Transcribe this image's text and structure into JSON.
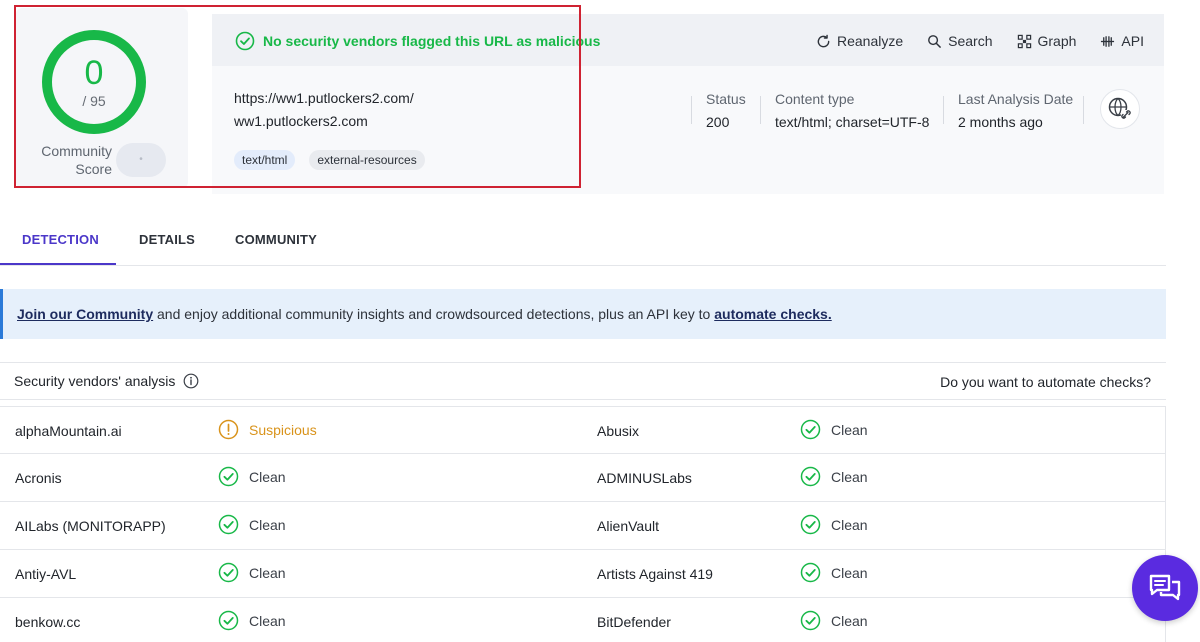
{
  "score": {
    "value": "0",
    "total": "/ 95",
    "community_label": "Community Score",
    "community_value": "•",
    "ring_color": "#18b848"
  },
  "verdict": {
    "text": "No security vendors flagged this URL as malicious",
    "color": "#18b848",
    "icon": "check-circle-icon"
  },
  "actions": [
    {
      "label": "Reanalyze",
      "icon": "refresh-icon"
    },
    {
      "label": "Search",
      "icon": "search-icon"
    },
    {
      "label": "Graph",
      "icon": "graph-icon"
    },
    {
      "label": "API",
      "icon": "api-icon"
    }
  ],
  "url": {
    "full": "https://ww1.putlockers2.com/",
    "host": "ww1.putlockers2.com",
    "tags": [
      "text/html",
      "external-resources"
    ]
  },
  "meta": {
    "status_label": "Status",
    "status_value": "200",
    "content_type_label": "Content type",
    "content_type_value": "text/html; charset=UTF-8",
    "last_analysis_label": "Last Analysis Date",
    "last_analysis_value": "2 months ago"
  },
  "tabs": [
    {
      "label": "DETECTION",
      "active": true
    },
    {
      "label": "DETAILS",
      "active": false
    },
    {
      "label": "COMMUNITY",
      "active": false
    }
  ],
  "banner": {
    "link1": "Join our Community",
    "text": " and enjoy additional community insights and crowdsourced detections, plus an API key to ",
    "link2": "automate checks."
  },
  "vendors_section": {
    "title": "Security vendors' analysis",
    "automate_prompt": "Do you want to automate checks?"
  },
  "vendors": [
    {
      "left": {
        "name": "alphaMountain.ai",
        "result": "Suspicious",
        "status": "suspicious"
      },
      "right": {
        "name": "Abusix",
        "result": "Clean",
        "status": "clean"
      }
    },
    {
      "left": {
        "name": "Acronis",
        "result": "Clean",
        "status": "clean"
      },
      "right": {
        "name": "ADMINUSLabs",
        "result": "Clean",
        "status": "clean"
      }
    },
    {
      "left": {
        "name": "AILabs (MONITORAPP)",
        "result": "Clean",
        "status": "clean"
      },
      "right": {
        "name": "AlienVault",
        "result": "Clean",
        "status": "clean"
      }
    },
    {
      "left": {
        "name": "Antiy-AVL",
        "result": "Clean",
        "status": "clean"
      },
      "right": {
        "name": "Artists Against 419",
        "result": "Clean",
        "status": "clean"
      }
    },
    {
      "left": {
        "name": "benkow.cc",
        "result": "Clean",
        "status": "clean"
      },
      "right": {
        "name": "BitDefender",
        "result": "Clean",
        "status": "clean"
      }
    }
  ],
  "colors": {
    "accent": "#4b37c9",
    "clean": "#18b848",
    "suspicious": "#d9931b",
    "highlight": "#cf2232",
    "chat": "#5a2be0"
  }
}
